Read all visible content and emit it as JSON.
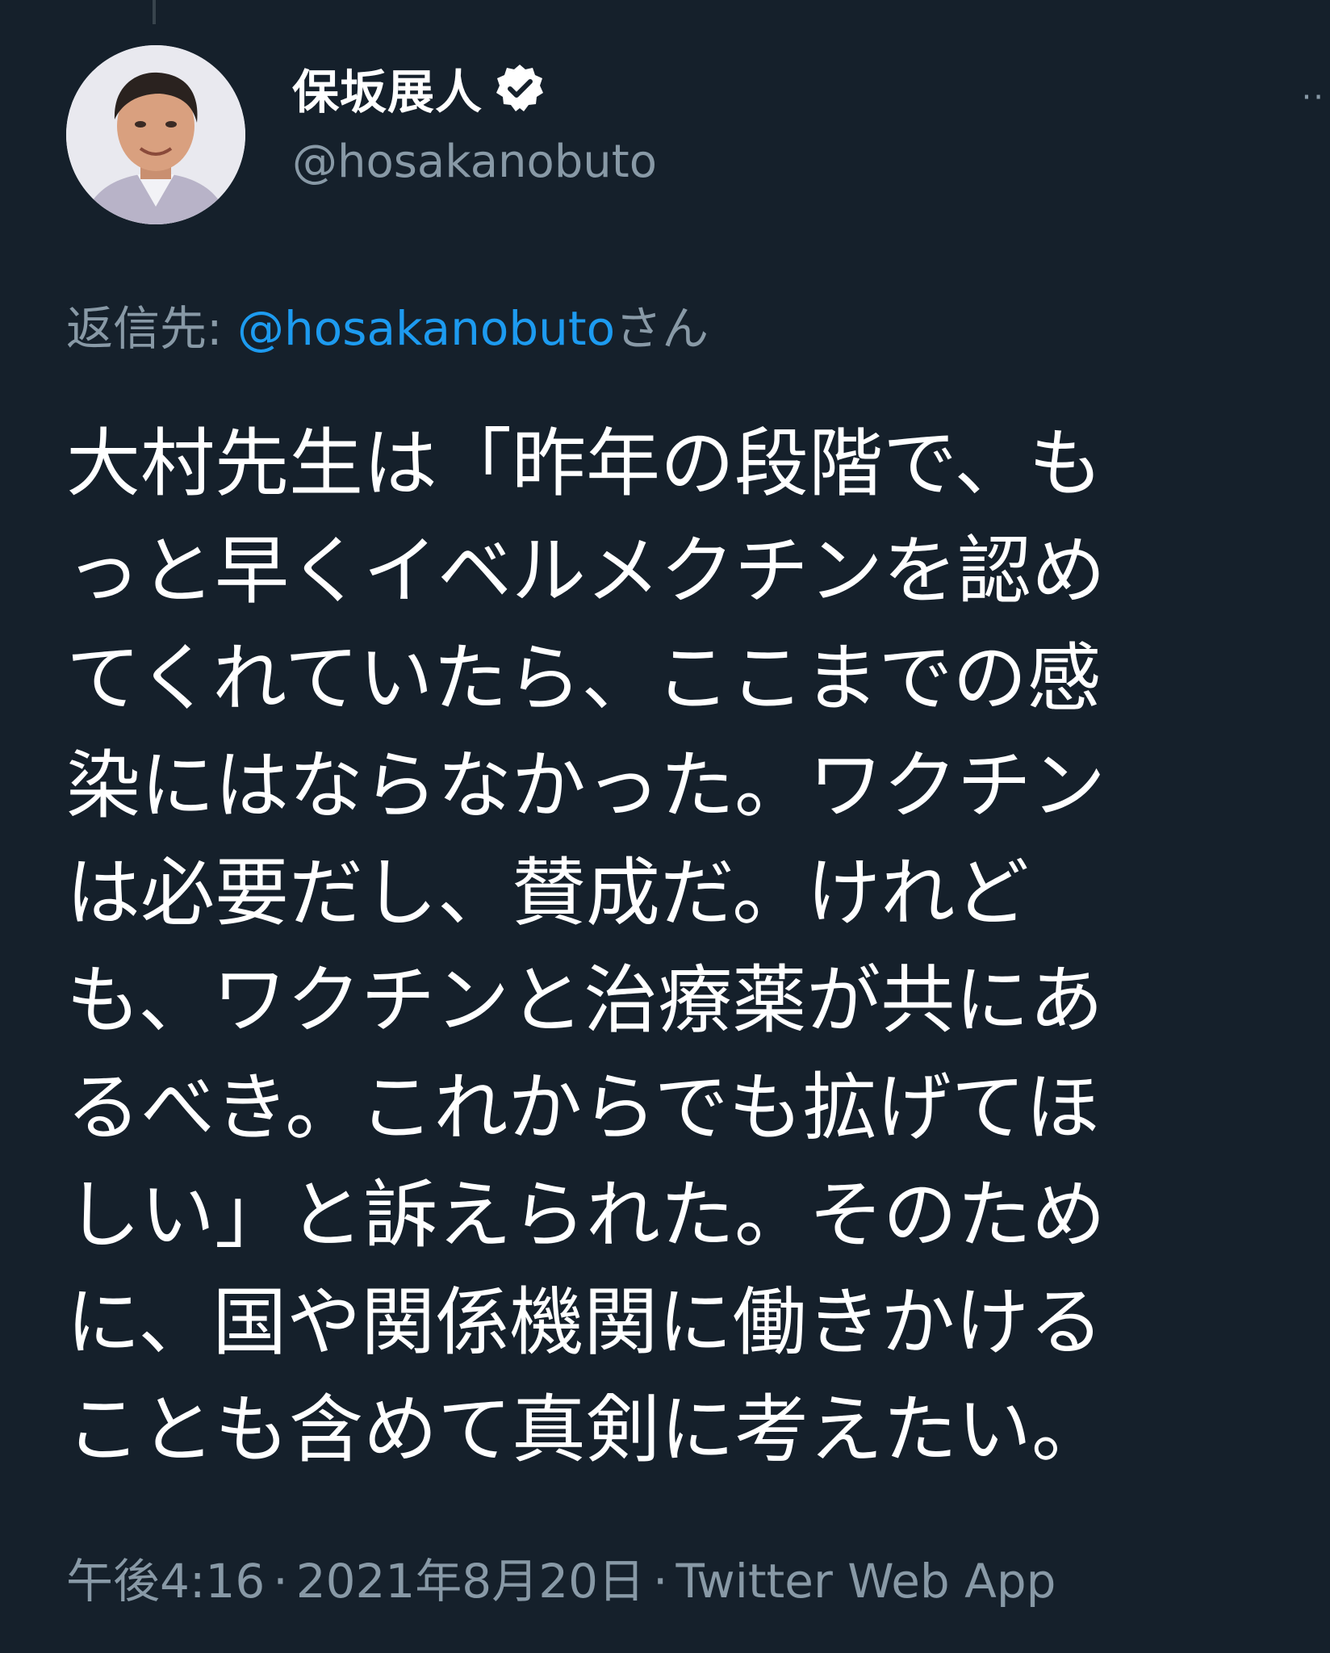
{
  "tweet": {
    "author": {
      "display_name": "保坂展人",
      "handle": "@hosakanobuto",
      "verified": true,
      "avatar_icon": "user-avatar-photo"
    },
    "reply": {
      "prefix": "返信先: ",
      "handle": "@hosakanobuto",
      "suffix": "さん"
    },
    "lines": [
      "大村先生は「昨年の段階で、も",
      "っと早くイベルメクチンを認め",
      "てくれていたら、ここまでの感",
      "染にはならなかった。ワクチン",
      "は必要だし、賛成だ。けれど",
      "も、ワクチンと治療薬が共にあ",
      "るべき。これからでも拡げてほ",
      "しい」と訴えられた。そのため",
      "に、国や関係機関に働きかける",
      "ことも含めて真剣に考えたい。"
    ],
    "meta": {
      "time": "午後4:16",
      "date": "2021年8月20日",
      "source": "Twitter Web App",
      "separator": "·"
    }
  },
  "colors": {
    "background": "#15202b",
    "text_primary": "#ffffff",
    "text_secondary": "#8899a6",
    "link": "#1d9bf0"
  }
}
